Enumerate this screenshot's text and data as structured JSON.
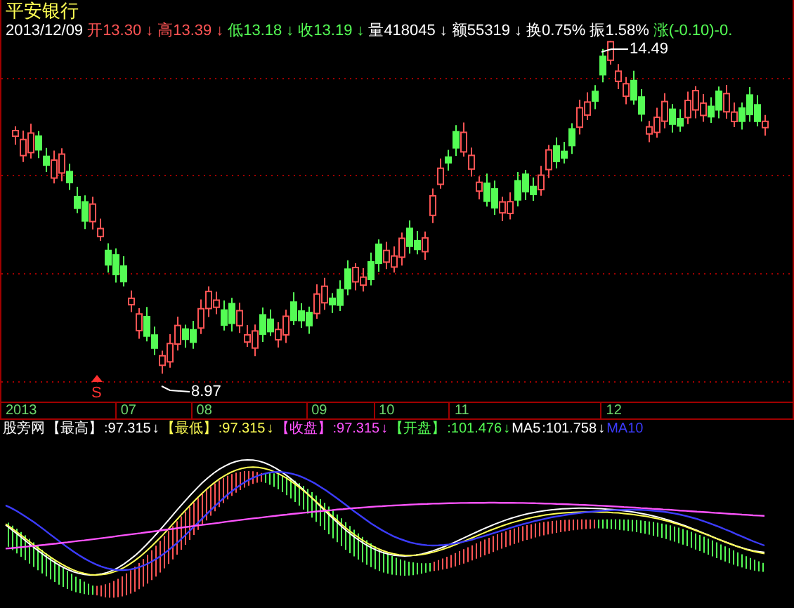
{
  "stock": {
    "name": "平安银行"
  },
  "quote": {
    "date": "2013/12/09",
    "fields": [
      {
        "label": "开",
        "value": "13.30",
        "arrow": "↓",
        "color": "#ff5454"
      },
      {
        "label": "高",
        "value": "13.39",
        "arrow": "↓",
        "color": "#ff5454"
      },
      {
        "label": "低",
        "value": "13.18",
        "arrow": "↓",
        "color": "#54fc54"
      },
      {
        "label": "收",
        "value": "13.19",
        "arrow": "↓",
        "color": "#54fc54"
      },
      {
        "label": "量",
        "value": "418045",
        "arrow": "↓",
        "color": "#ffffff"
      },
      {
        "label": "额",
        "value": "55319",
        "arrow": "↓",
        "color": "#ffffff"
      },
      {
        "label": "换",
        "value": "0.75%",
        "color": "#ffffff"
      },
      {
        "label": "振",
        "value": "1.58%",
        "color": "#ffffff"
      },
      {
        "label": "涨",
        "value": "(-0.10)-0.",
        "color": "#54fc54"
      }
    ]
  },
  "price_chart": {
    "high_label": "14.49",
    "low_label": "8.97",
    "signal": {
      "text": "S"
    }
  },
  "time_axis": {
    "labels": [
      "2013",
      "07",
      "08",
      "09",
      "10",
      "11",
      "12"
    ]
  },
  "indicator": {
    "name": "股旁网",
    "items": [
      {
        "label": "【最高】",
        "value": ":97.315",
        "arrow": "↓",
        "color": "#ffffff"
      },
      {
        "label": "【最低】",
        "value": ":97.315",
        "arrow": "↓",
        "color": "#ffff54"
      },
      {
        "label": "【收盘】",
        "value": ":97.315",
        "arrow": "↓",
        "color": "#ff54ff"
      },
      {
        "label": "【开盘】",
        "value": ":101.476",
        "arrow": "↓",
        "color": "#54fc54"
      },
      {
        "label": "MA5",
        "value": ":101.758",
        "arrow": "↓",
        "color": "#ffffff"
      },
      {
        "label": "MA10",
        "color": "#3c3cff"
      }
    ]
  }
}
